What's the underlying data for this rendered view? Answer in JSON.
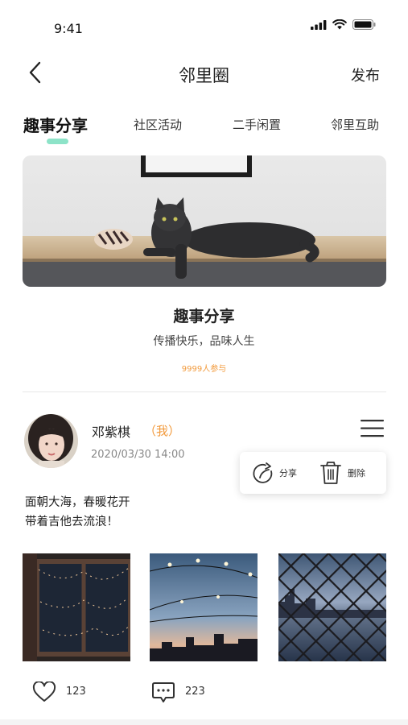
{
  "status_bar": {
    "time": "9:41",
    "icons": [
      "signal-icon",
      "wifi-icon",
      "battery-icon"
    ]
  },
  "nav": {
    "back_icon": "chevron-left-icon",
    "title": "邻里圈",
    "publish_label": "发布"
  },
  "tabs": [
    {
      "label": "趣事分享",
      "active": true
    },
    {
      "label": "社区活动",
      "active": false
    },
    {
      "label": "二手闲置",
      "active": false
    },
    {
      "label": "邻里互助",
      "active": false
    }
  ],
  "colors": {
    "accent_mint": "#8de3c8",
    "accent_orange": "#f29a3c"
  },
  "topic": {
    "title": "趣事分享",
    "subtitle": "传播快乐，品味人生",
    "participants": "9999人参与"
  },
  "post": {
    "author": "邓紫棋",
    "tag": "（我）",
    "date": "2020/03/30  14:00",
    "menu_icon": "hamburger-menu-icon",
    "popup": {
      "share_label": "分享",
      "delete_label": "删除"
    },
    "text_lines": [
      "面朝大海，春暖花开",
      "带着吉他去流浪！"
    ],
    "likes": "123",
    "comments": "223"
  }
}
